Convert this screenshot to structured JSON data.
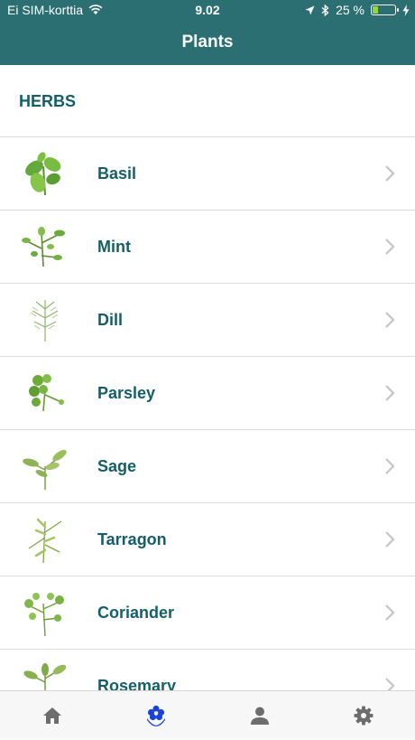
{
  "status_bar": {
    "carrier": "Ei SIM-korttia",
    "time": "9.02",
    "battery_text": "25 %",
    "battery_level": 0.25
  },
  "nav": {
    "title": "Plants"
  },
  "section": {
    "title": "HERBS"
  },
  "items": [
    {
      "label": "Basil"
    },
    {
      "label": "Mint"
    },
    {
      "label": "Dill"
    },
    {
      "label": "Parsley"
    },
    {
      "label": "Sage"
    },
    {
      "label": "Tarragon"
    },
    {
      "label": "Coriander"
    },
    {
      "label": "Rosemary"
    }
  ],
  "tab_bar": {
    "tabs": [
      {
        "icon": "home-icon",
        "active": false
      },
      {
        "icon": "plant-icon",
        "active": true
      },
      {
        "icon": "user-icon",
        "active": false
      },
      {
        "icon": "gear-icon",
        "active": false
      }
    ],
    "active_color": "#1a44d6",
    "inactive_color": "#6d6d6d"
  },
  "colors": {
    "header_bg": "#2b6f72",
    "label": "#135e6a"
  }
}
